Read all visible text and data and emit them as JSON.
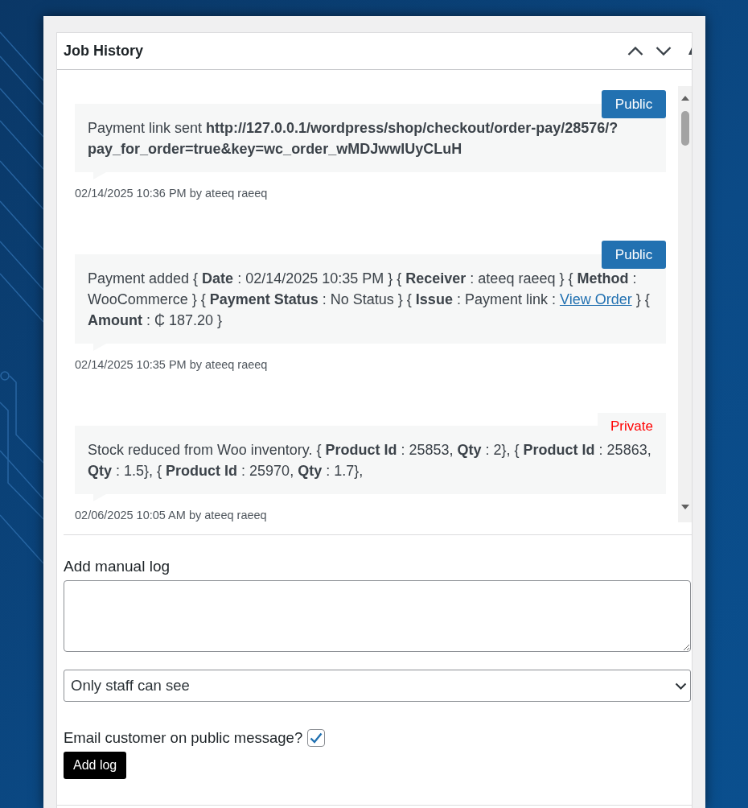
{
  "panel": {
    "title": "Job History"
  },
  "messages": [
    {
      "kind": "public",
      "badge": "Public",
      "text": "Payment link sent **http://127.0.0.1/wordpress/shop/checkout/order-pay/28576/?pay_for_order=true&key=wc_order_wMDJwwIUyCLuH**",
      "meta": "02/14/2025 10:36 PM by ateeq raeeq"
    },
    {
      "kind": "public",
      "badge": "Public",
      "text": "Payment added { **Date** : 02/14/2025 10:35 PM } { **Receiver** : ateeq raeeq } { **Method** : WooCommerce } { **Payment Status** : No Status } { **Issue** : Payment link : ",
      "link": "View Order",
      "text_after": " } { **Amount** : ₵ 187.20 }",
      "meta": "02/14/2025 10:35 PM by ateeq raeeq"
    },
    {
      "kind": "private",
      "badge": "Private",
      "text": "Stock reduced from Woo inventory. { **Product Id** : 25853, **Qty** : 2}, { **Product Id** : 25863, **Qty** : 1.5}, { **Product Id** : 25970, **Qty** : 1.7},",
      "meta": "02/06/2025 10:05 AM by ateeq raeeq"
    }
  ],
  "manual_log": {
    "label": "Add manual log"
  },
  "visibility_select": {
    "value": "Only staff can see"
  },
  "email_customer": {
    "label": "Email customer on public message?",
    "checked": true
  },
  "add_button": {
    "label": "Add log"
  }
}
